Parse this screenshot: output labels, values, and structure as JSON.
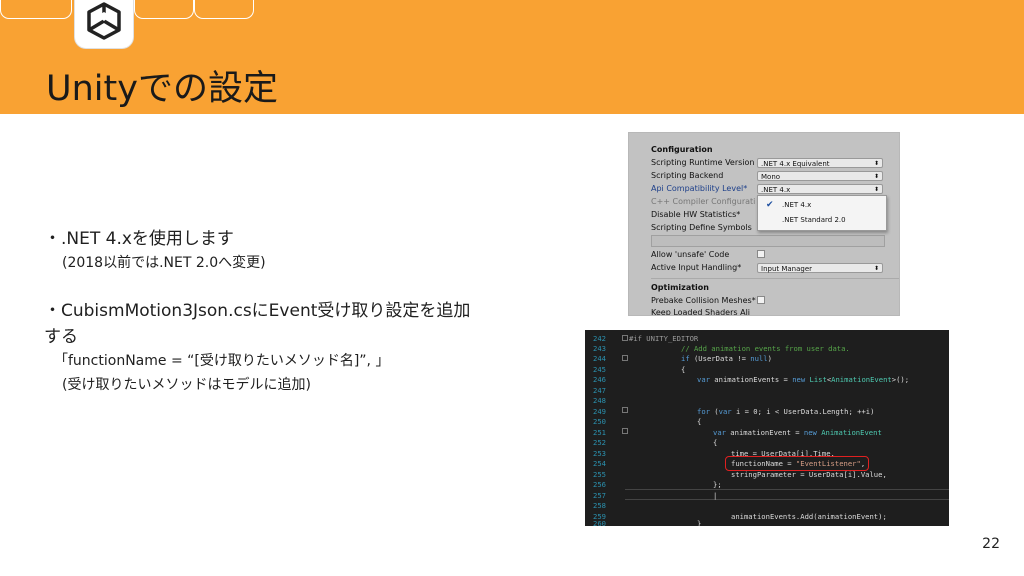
{
  "header": {
    "title": "Unityでの設定",
    "logo": "unity-logo",
    "colors": {
      "banner": "#f9a233"
    }
  },
  "content": {
    "line1": "・.NET 4.xを使用します",
    "line2": "(2018以前では.NET 2.0へ変更)",
    "line3": "・CubismMotion3Json.csにEvent受け取り設定を追加",
    "line4": "する",
    "line5": "「functionName = “[受け取りたいメソッド名]”, 」",
    "line6": "(受け取りたいメソッドはモデルに追加)"
  },
  "settings_panel": {
    "section_configuration": "Configuration",
    "rows": [
      {
        "label": "Scripting Runtime Version",
        "value": ".NET 4.x Equivalent"
      },
      {
        "label": "Scripting Backend",
        "value": "Mono"
      },
      {
        "label": "Api Compatibility Level*",
        "value": ".NET 4.x"
      },
      {
        "label": "C++ Compiler Configurati"
      },
      {
        "label": "Disable HW Statistics*"
      },
      {
        "label": "Scripting Define Symbols"
      },
      {
        "label": "Allow 'unsafe' Code"
      },
      {
        "label": "Active Input Handling*",
        "value": "Input Manager"
      }
    ],
    "popup_options": [
      ".NET 4.x",
      ".NET Standard 2.0"
    ],
    "section_optimization": "Optimization",
    "opt_rows": [
      "Prebake Collision Meshes*",
      "Keep Loaded Shaders Ali"
    ]
  },
  "code_editor": {
    "line_numbers": [
      "242",
      "243",
      "244",
      "245",
      "246",
      "247",
      "248",
      "249",
      "250",
      "251",
      "252",
      "253",
      "254",
      "255",
      "256",
      "257",
      "258",
      "259",
      "260"
    ],
    "lines": {
      "l242a": "#if",
      "l242b": " UNITY_EDITOR",
      "l243": "// Add animation events from user data.",
      "l244a": "if",
      "l244b": " (UserData != ",
      "l244c": "null",
      "l244d": ")",
      "l245": "{",
      "l246a": "var",
      "l246b": " animationEvents = ",
      "l246c": "new",
      "l246d": " ",
      "l246e": "List",
      "l246f": "<",
      "l246g": "AnimationEvent",
      "l246h": ">();",
      "l249a": "for",
      "l249b": " (",
      "l249c": "var",
      "l249d": " i = 0; i < UserData.Length; ++i)",
      "l250": "{",
      "l251a": "var",
      "l251b": " animationEvent = ",
      "l251c": "new",
      "l251d": " ",
      "l251e": "AnimationEvent",
      "l252": "{",
      "l253": "time = UserData[i].Time,",
      "l254a": "functionName = ",
      "l254b": "\"EventListener\"",
      "l254c": ",",
      "l255": "stringParameter = UserData[i].Value,",
      "l256": "};",
      "l257": "|",
      "l259": "animationEvents.Add(animationEvent);",
      "l260": "}"
    },
    "colors": {
      "keyword": "#569cd6",
      "comment": "#57a64a",
      "type": "#4ec9b0",
      "string": "#d69d85",
      "highlight_box": "#e02020"
    }
  },
  "footer": {
    "page_number": "22"
  }
}
